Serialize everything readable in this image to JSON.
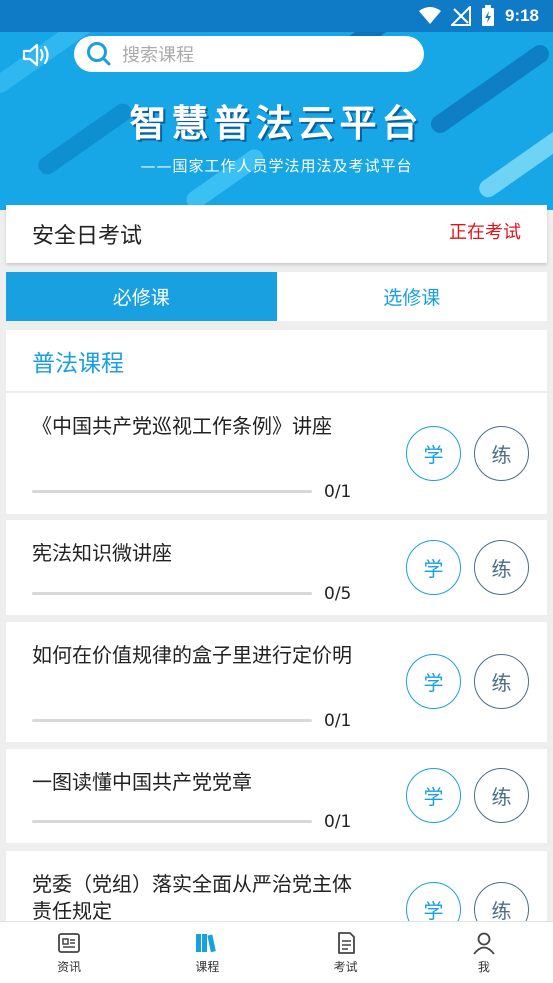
{
  "status_bar": {
    "time": "9:18"
  },
  "header": {
    "search_placeholder": "搜索课程",
    "banner_title": "智慧普法云平台",
    "banner_subtitle": "——国家工作人员学法用法及考试平台"
  },
  "exam": {
    "title": "安全日考试",
    "status": "正在考试"
  },
  "tabs": [
    {
      "label": "必修课",
      "active": true
    },
    {
      "label": "选修课",
      "active": false
    }
  ],
  "section": {
    "title": "普法课程"
  },
  "courses": [
    {
      "name": "《中国共产党巡视工作条例》讲座",
      "count": "0/1",
      "progress": 0,
      "study_label": "学",
      "practice_label": "练"
    },
    {
      "name": "宪法知识微讲座",
      "count": "0/5",
      "progress": 0,
      "study_label": "学",
      "practice_label": "练"
    },
    {
      "name": "如何在价值规律的盒子里进行定价明",
      "count": "0/1",
      "progress": 0,
      "study_label": "学",
      "practice_label": "练"
    },
    {
      "name": "一图读懂中国共产党党章",
      "count": "0/1",
      "progress": 0,
      "study_label": "学",
      "practice_label": "练"
    },
    {
      "name": "党委（党组）落实全面从严治党主体责任规定",
      "count": "",
      "progress": 0,
      "study_label": "学",
      "practice_label": "练"
    }
  ],
  "bottom_nav": [
    {
      "label": "资讯",
      "icon": "news-icon",
      "active": false
    },
    {
      "label": "课程",
      "icon": "courses-icon",
      "active": true
    },
    {
      "label": "考试",
      "icon": "exam-icon",
      "active": false
    },
    {
      "label": "我",
      "icon": "profile-icon",
      "active": false
    }
  ],
  "colors": {
    "accent": "#19a0e0",
    "banner": "#17a6e6",
    "status_red": "#e0141a"
  }
}
